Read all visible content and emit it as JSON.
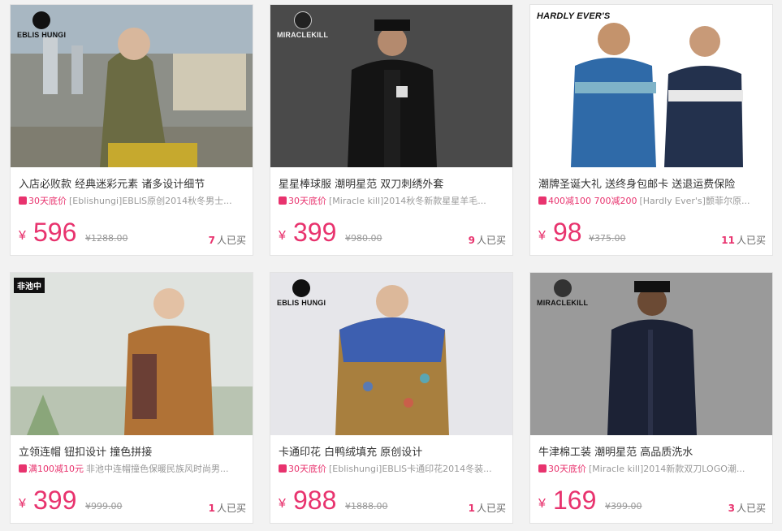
{
  "products": [
    {
      "brand": "EBLIS HUNGI",
      "title": "入店必败款 经典迷彩元素 诸多设计细节",
      "promo_tag": "30天底价",
      "promo_text": "[Eblishungi]EBLIS原创2014秋冬男士...",
      "currency": "¥",
      "price": "596",
      "original_price": "¥1288.00",
      "sold_count": "7",
      "sold_label": "人已买"
    },
    {
      "brand": "MIRACLEKILL",
      "title": "星星棒球服 潮明星范 双刀刺绣外套",
      "promo_tag": "30天底价",
      "promo_text": "[Miracle kill]2014秋冬新款星星羊毛...",
      "currency": "¥",
      "price": "399",
      "original_price": "¥980.00",
      "sold_count": "9",
      "sold_label": "人已买"
    },
    {
      "brand": "HARDLY EVER'S",
      "title": "潮牌圣诞大礼 送终身包邮卡 送退运费保险",
      "promo_tag": "400减100 700减200",
      "promo_text": "[Hardly Ever's]颤菲尔原...",
      "currency": "¥",
      "price": "98",
      "original_price": "¥375.00",
      "sold_count": "11",
      "sold_label": "人已买"
    },
    {
      "brand": "非池中",
      "title": "立领连帽 钮扣设计 撞色拼接",
      "promo_tag": "满100减10元",
      "promo_text": "非池中连帽撞色保暖民族风时尚男...",
      "currency": "¥",
      "price": "399",
      "original_price": "¥999.00",
      "sold_count": "1",
      "sold_label": "人已买"
    },
    {
      "brand": "EBLIS HUNGI",
      "title": "卡通印花 白鸭绒填充 原创设计",
      "promo_tag": "30天底价",
      "promo_text": "[Eblishungi]EBLIS卡通印花2014冬装...",
      "currency": "¥",
      "price": "988",
      "original_price": "¥1888.00",
      "sold_count": "1",
      "sold_label": "人已买"
    },
    {
      "brand": "MIRACLEKILL",
      "title": "牛津棉工装 潮明星范 高品质洗水",
      "promo_tag": "30天底价",
      "promo_text": "[Miracle kill]2014新款双刀LOGO潮...",
      "currency": "¥",
      "price": "169",
      "original_price": "¥399.00",
      "sold_count": "3",
      "sold_label": "人已买"
    }
  ],
  "colors": {
    "accent": "#e8336e",
    "muted": "#999999",
    "background": "#f2f2f2"
  }
}
